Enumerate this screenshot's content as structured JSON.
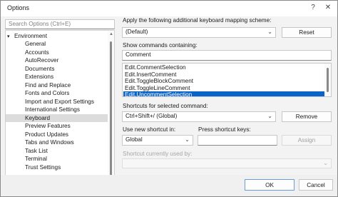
{
  "window": {
    "title": "Options"
  },
  "search": {
    "placeholder": "Search Options (Ctrl+E)"
  },
  "tree": {
    "root": "Environment",
    "items": [
      "General",
      "Accounts",
      "AutoRecover",
      "Documents",
      "Extensions",
      "Find and Replace",
      "Fonts and Colors",
      "Import and Export Settings",
      "International Settings",
      "Keyboard",
      "Preview Features",
      "Product Updates",
      "Tabs and Windows",
      "Task List",
      "Terminal",
      "Trust Settings"
    ],
    "selected_index": 9
  },
  "mapping": {
    "label": "Apply the following additional keyboard mapping scheme:",
    "value": "(Default)",
    "reset_label": "Reset"
  },
  "commands": {
    "label": "Show commands containing:",
    "filter_value": "Comment",
    "items": [
      "Edit.CommentSelection",
      "Edit.InsertComment",
      "Edit.ToggleBlockComment",
      "Edit.ToggleLineComment",
      "Edit.UncommentSelection"
    ],
    "selected_index": 4
  },
  "shortcuts": {
    "label": "Shortcuts for selected command:",
    "value": "Ctrl+Shift+/ (Global)",
    "remove_label": "Remove"
  },
  "new_shortcut": {
    "use_in_label": "Use new shortcut in:",
    "use_in_value": "Global",
    "press_label": "Press shortcut keys:",
    "press_value": "",
    "assign_label": "Assign"
  },
  "used_by": {
    "label": "Shortcut currently used by:",
    "value": ""
  },
  "footer": {
    "ok_label": "OK",
    "cancel_label": "Cancel"
  }
}
